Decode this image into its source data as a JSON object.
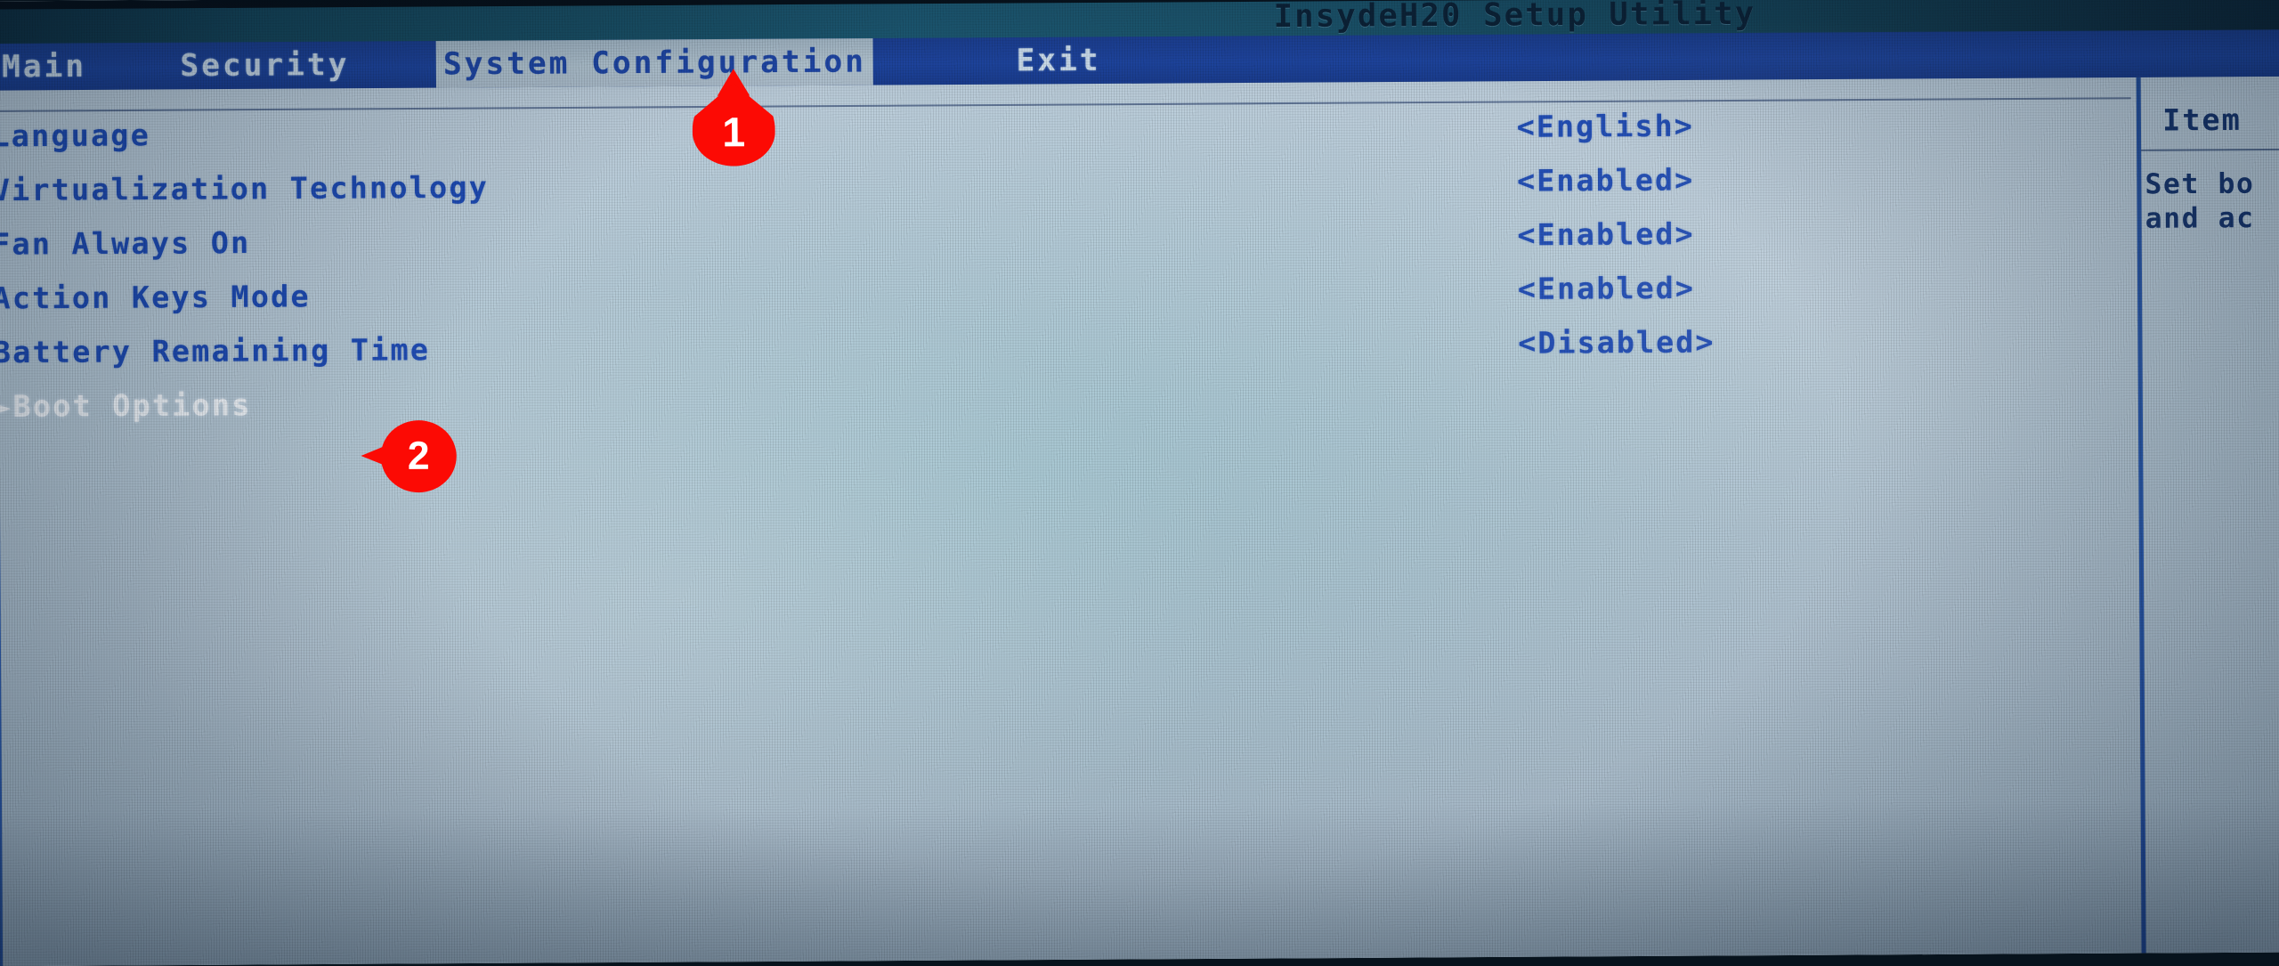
{
  "window": {
    "title": "InsydeH20 Setup Utility"
  },
  "menubar": {
    "items": [
      {
        "label": "Main",
        "active": false
      },
      {
        "label": "Security",
        "active": false
      },
      {
        "label": "System Configuration",
        "active": true
      },
      {
        "label": "Exit",
        "active": false
      }
    ]
  },
  "settings": {
    "rows": [
      {
        "label": "Language",
        "value": "<English>",
        "selected": false,
        "submenu": false
      },
      {
        "label": "Virtualization Technology",
        "value": "<Enabled>",
        "selected": false,
        "submenu": false
      },
      {
        "label": "Fan Always On",
        "value": "<Enabled>",
        "selected": false,
        "submenu": false
      },
      {
        "label": "Action Keys Mode",
        "value": "<Enabled>",
        "selected": false,
        "submenu": false
      },
      {
        "label": "Battery Remaining Time",
        "value": "<Disabled>",
        "selected": false,
        "submenu": false
      },
      {
        "label": "►Boot Options",
        "value": "",
        "selected": true,
        "submenu": true
      }
    ]
  },
  "help": {
    "title": "Item",
    "body": "Set bo\nand ac"
  },
  "annotations": {
    "markers": [
      {
        "number": "1",
        "target": "System Configuration menu tab"
      },
      {
        "number": "2",
        "target": "Boot Options row"
      }
    ]
  },
  "colors": {
    "marker_red": "#fc0a04",
    "menubar_blue": "#1e45a0",
    "text_blue": "#1e4bb4",
    "selected_text": "#f2f6fa",
    "page_background": "#b7c9d6",
    "titlebar_teal": "#1a5166"
  }
}
